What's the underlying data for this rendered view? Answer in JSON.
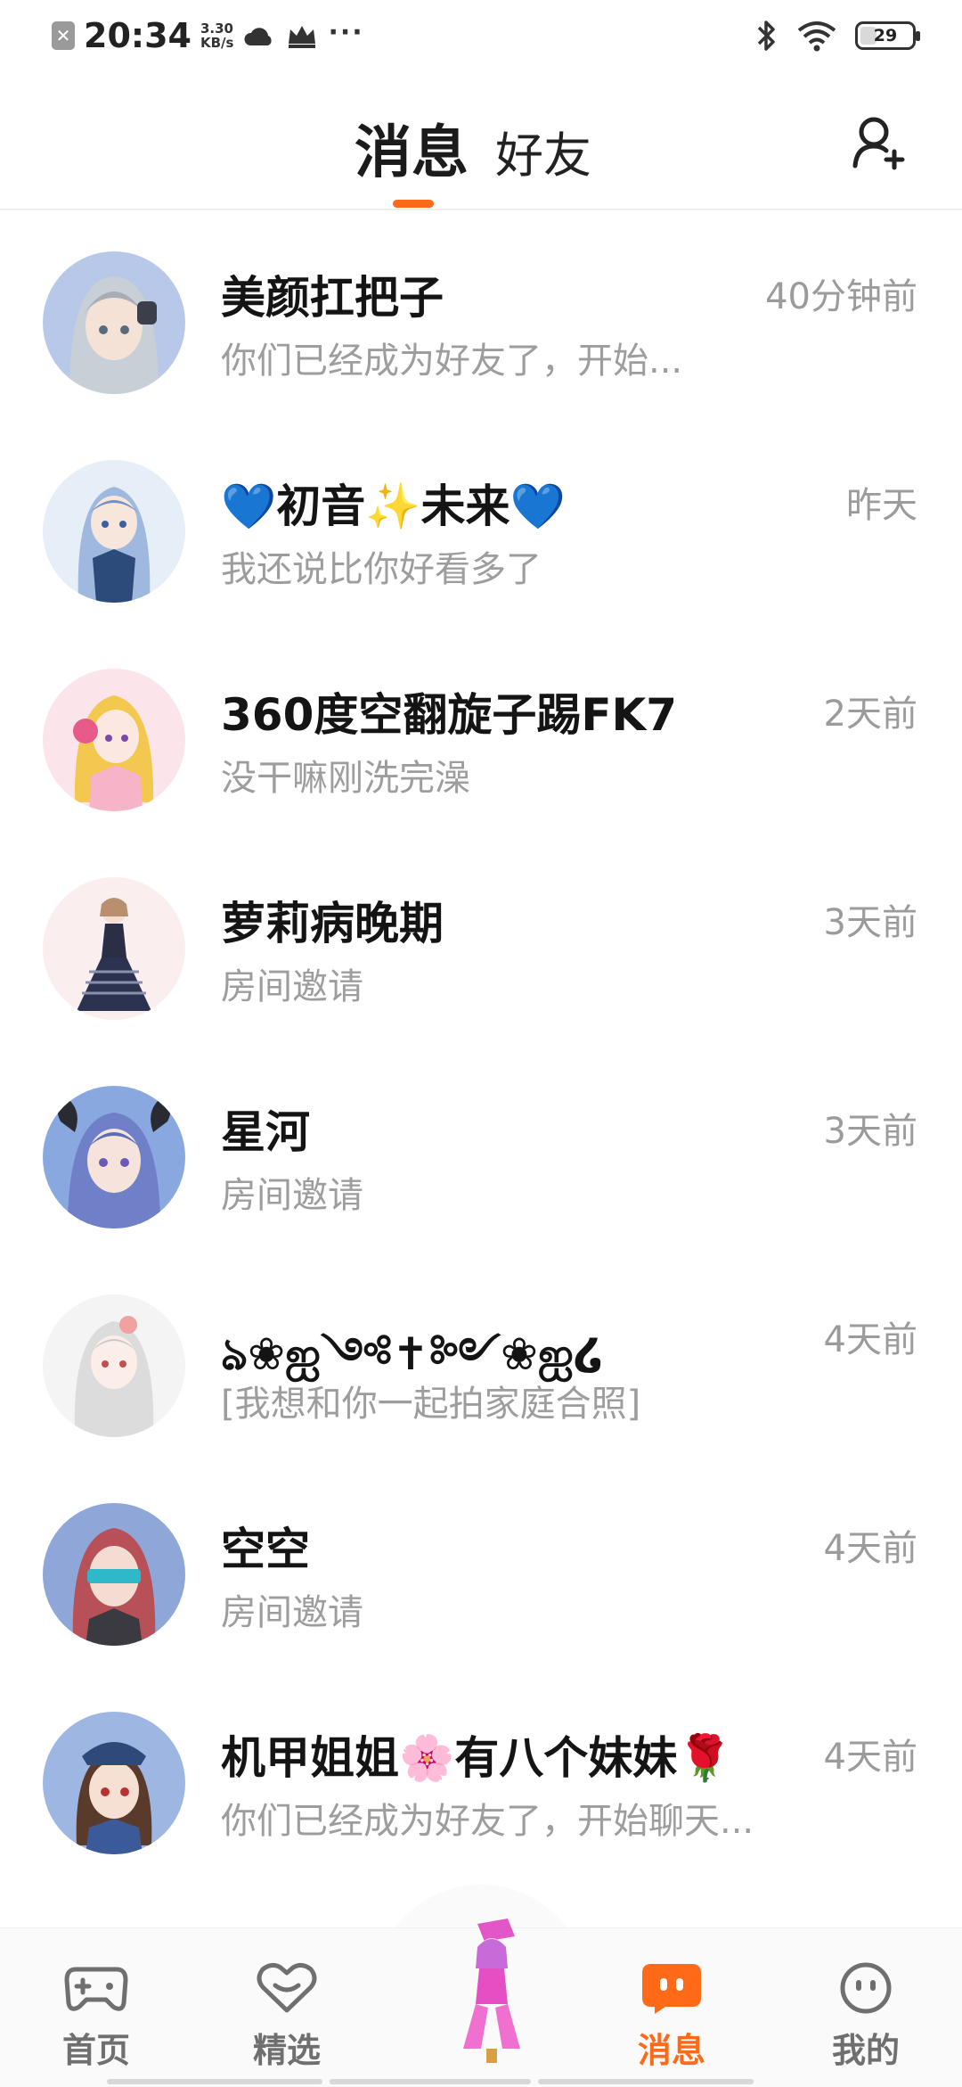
{
  "status_bar": {
    "time": "20:34",
    "speed_value": "3.30",
    "speed_unit": "KB/s",
    "battery": "29",
    "more": "···"
  },
  "header": {
    "tab_messages": "消息",
    "tab_friends": "好友",
    "accent_color": "#ff6a18"
  },
  "chats": [
    {
      "name": "美颜扛把子",
      "time": "40分钟前",
      "preview": "你们已经成为好友了，开始..."
    },
    {
      "name": "💙初音✨未来💙",
      "time": "昨天",
      "preview": "我还说比你好看多了"
    },
    {
      "name": "360度空翻旋子踢FK7",
      "time": "2天前",
      "preview": "没干嘛刚洗完澡"
    },
    {
      "name": "萝莉病晚期",
      "time": "3天前",
      "preview": "房间邀请"
    },
    {
      "name": "星河",
      "time": "3天前",
      "preview": "房间邀请"
    },
    {
      "name": "ঌ❀ஐ༺✝༻❀ஐ໒",
      "time": "4天前",
      "preview": "[我想和你一起拍家庭合照]"
    },
    {
      "name": "空空",
      "time": "4天前",
      "preview": "房间邀请"
    },
    {
      "name": "机甲姐姐🌸有八个妹妹🌹",
      "time": "4天前",
      "preview": "你们已经成为好友了，开始聊天..."
    }
  ],
  "bottom_nav": {
    "home": "首页",
    "featured": "精选",
    "messages": "消息",
    "me": "我的"
  }
}
